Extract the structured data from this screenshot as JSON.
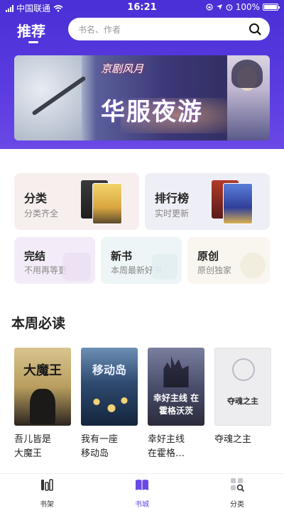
{
  "status_bar": {
    "carrier": "中国联通",
    "time": "16:21",
    "battery": "100%"
  },
  "header": {
    "title": "推荐",
    "search_placeholder": "书名、作者"
  },
  "banner": {
    "label_top": "京剧风月",
    "label_main": "华服夜游"
  },
  "categories": {
    "classify": {
      "title": "分类",
      "subtitle": "分类齐全"
    },
    "ranking": {
      "title": "排行榜",
      "subtitle": "实时更新"
    },
    "finished": {
      "title": "完结",
      "subtitle": "不用再等更"
    },
    "new_books": {
      "title": "新书",
      "subtitle": "本周最新好书"
    },
    "original": {
      "title": "原创",
      "subtitle": "原创独家"
    }
  },
  "weekly": {
    "section_title": "本周必读",
    "books": [
      {
        "title_line1": "吾儿皆是",
        "title_line2": "大魔王",
        "cover_text": "大魔王",
        "cover_color": "#c9b07a"
      },
      {
        "title_line1": "我有一座",
        "title_line2": "移动岛",
        "cover_text": "移动岛",
        "cover_color": "#2d4a6e"
      },
      {
        "title_line1": "幸好主线",
        "title_line2": "在霍格…",
        "cover_text": "幸好主线 在霍格沃茨",
        "cover_color": "#4b4e6b"
      },
      {
        "title_line1": "夺魂之主",
        "title_line2": "",
        "cover_text": "夺魂之主",
        "cover_color": "#e9e9ec"
      }
    ]
  },
  "tabbar": {
    "tabs": [
      {
        "label": "书架",
        "icon": "bookshelf-icon"
      },
      {
        "label": "书城",
        "icon": "book-open-icon"
      },
      {
        "label": "分类",
        "icon": "category-search-icon"
      }
    ]
  },
  "colors": {
    "accent": "#6a48e6",
    "header_bg": "#4a2fd6"
  }
}
